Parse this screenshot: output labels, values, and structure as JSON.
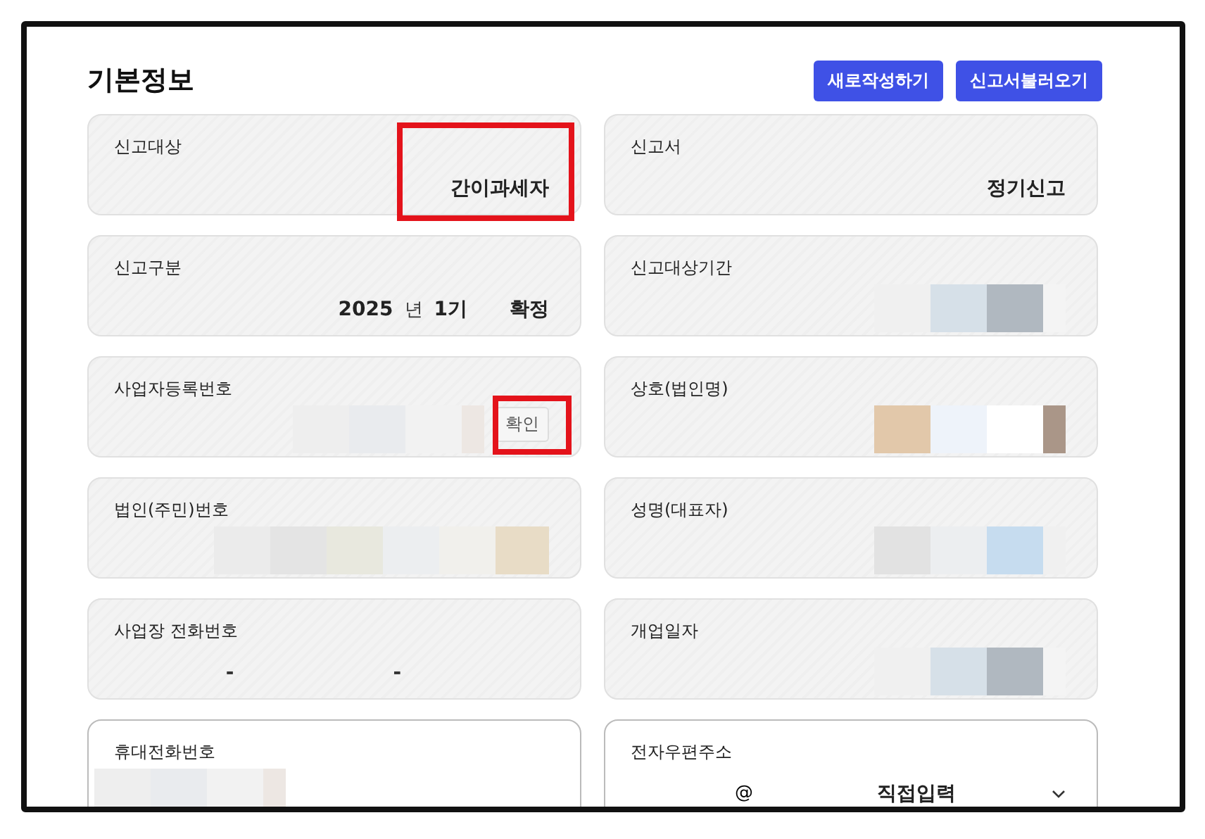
{
  "title": "기본정보",
  "buttons": [
    "새로작성하기",
    "신고서불러오기"
  ],
  "fields": [
    {
      "kind": "text",
      "label": "신고대상",
      "value": "간이과세자",
      "highlighted": true
    },
    {
      "kind": "text",
      "label": "신고서",
      "value": "정기신고",
      "highlighted": false
    },
    {
      "kind": "period",
      "label": "신고구분",
      "year": "2025",
      "year_unit": "년",
      "term": "1기",
      "status": "확정",
      "highlighted": false
    },
    {
      "kind": "redacted",
      "label": "신고대상기간",
      "highlighted": false
    },
    {
      "kind": "verify",
      "label": "사업자등록번호",
      "button": "확인",
      "highlighted": true
    },
    {
      "kind": "redacted",
      "label": "상호(법인명)",
      "highlighted": false
    },
    {
      "kind": "redacted",
      "label": "법인(주민)번호",
      "highlighted": false
    },
    {
      "kind": "redacted",
      "label": "성명(대표자)",
      "highlighted": false
    },
    {
      "kind": "phone",
      "label": "사업장 전화번호",
      "separators": [
        "-",
        "-"
      ],
      "highlighted": false
    },
    {
      "kind": "redacted",
      "label": "개업일자",
      "highlighted": false
    },
    {
      "kind": "redacted_open",
      "label": "휴대전화번호",
      "highlighted": false
    },
    {
      "kind": "email",
      "label": "전자우편주소",
      "at": "@",
      "domain": "직접입력",
      "highlighted": false
    }
  ]
}
